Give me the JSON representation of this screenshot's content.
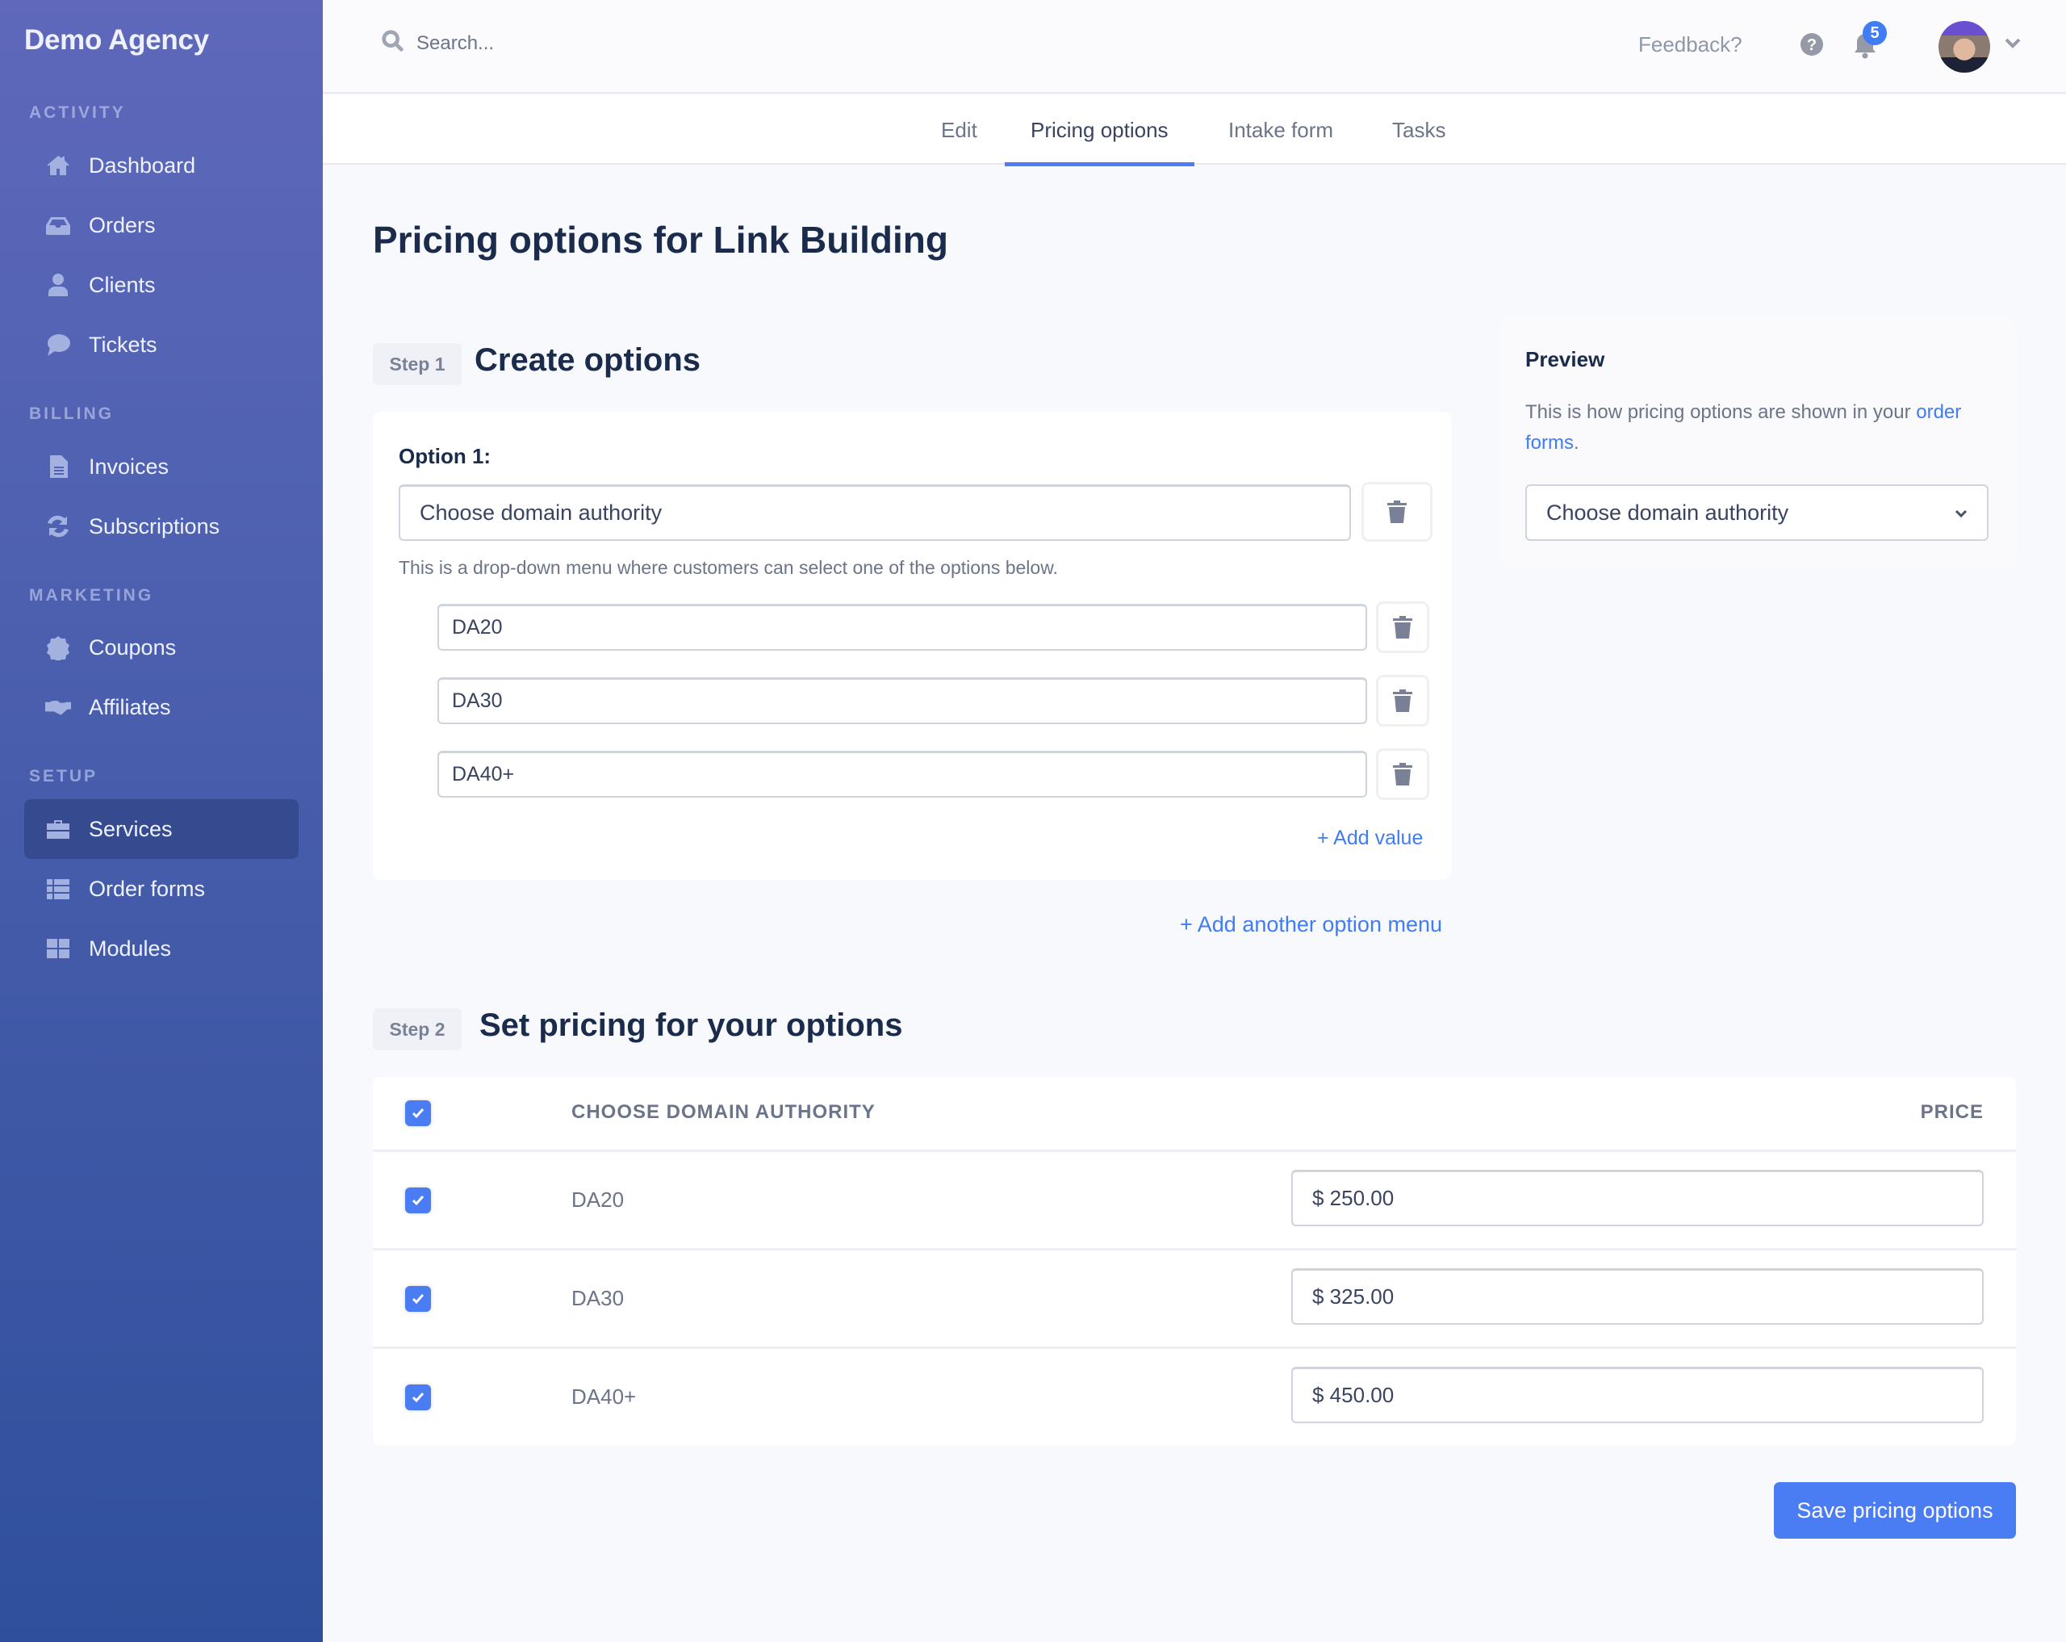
{
  "sidebar": {
    "brand": "Demo Agency",
    "sections": [
      {
        "title": "ACTIVITY",
        "items": [
          {
            "label": "Dashboard",
            "icon": "home-icon"
          },
          {
            "label": "Orders",
            "icon": "inbox-icon"
          },
          {
            "label": "Clients",
            "icon": "user-icon"
          },
          {
            "label": "Tickets",
            "icon": "comment-icon"
          }
        ]
      },
      {
        "title": "BILLING",
        "items": [
          {
            "label": "Invoices",
            "icon": "file-icon"
          },
          {
            "label": "Subscriptions",
            "icon": "refresh-icon"
          }
        ]
      },
      {
        "title": "MARKETING",
        "items": [
          {
            "label": "Coupons",
            "icon": "percent-badge-icon"
          },
          {
            "label": "Affiliates",
            "icon": "handshake-icon"
          }
        ]
      },
      {
        "title": "SETUP",
        "items": [
          {
            "label": "Services",
            "icon": "toolbox-icon",
            "active": true
          },
          {
            "label": "Order forms",
            "icon": "list-icon"
          },
          {
            "label": "Modules",
            "icon": "grid-icon"
          }
        ]
      }
    ]
  },
  "topbar": {
    "search_placeholder": "Search...",
    "feedback": "Feedback?",
    "notification_count": "5"
  },
  "tabs": [
    {
      "label": "Edit"
    },
    {
      "label": "Pricing options",
      "active": true
    },
    {
      "label": "Intake form"
    },
    {
      "label": "Tasks"
    }
  ],
  "page": {
    "title": "Pricing options for Link Building"
  },
  "step1": {
    "badge": "Step 1",
    "title": "Create options",
    "option_label": "Option 1:",
    "option_name": "Choose domain authority",
    "helper": "This is a drop-down menu where customers can select one of the options below.",
    "values": [
      "DA20",
      "DA30",
      "DA40+"
    ],
    "add_value": "+ Add value",
    "add_option_menu": "+ Add another option menu"
  },
  "preview": {
    "title": "Preview",
    "text_before": "This is how pricing options are shown in your ",
    "link": "order forms",
    "text_after": ".",
    "select_value": "Choose domain authority"
  },
  "step2": {
    "badge": "Step 2",
    "title": "Set pricing for your options",
    "columns": [
      "CHOOSE DOMAIN AUTHORITY",
      "PRICE"
    ],
    "rows": [
      {
        "option": "DA20",
        "price": "$ 250.00",
        "checked": true
      },
      {
        "option": "DA30",
        "price": "$ 325.00",
        "checked": true
      },
      {
        "option": "DA40+",
        "price": "$ 450.00",
        "checked": true
      }
    ],
    "save": "Save pricing options"
  },
  "colors": {
    "accent": "#4a7cf4",
    "sidebar_top": "#5f68bb",
    "sidebar_bottom": "#2f4f9c",
    "heading": "#1a2b4c"
  }
}
